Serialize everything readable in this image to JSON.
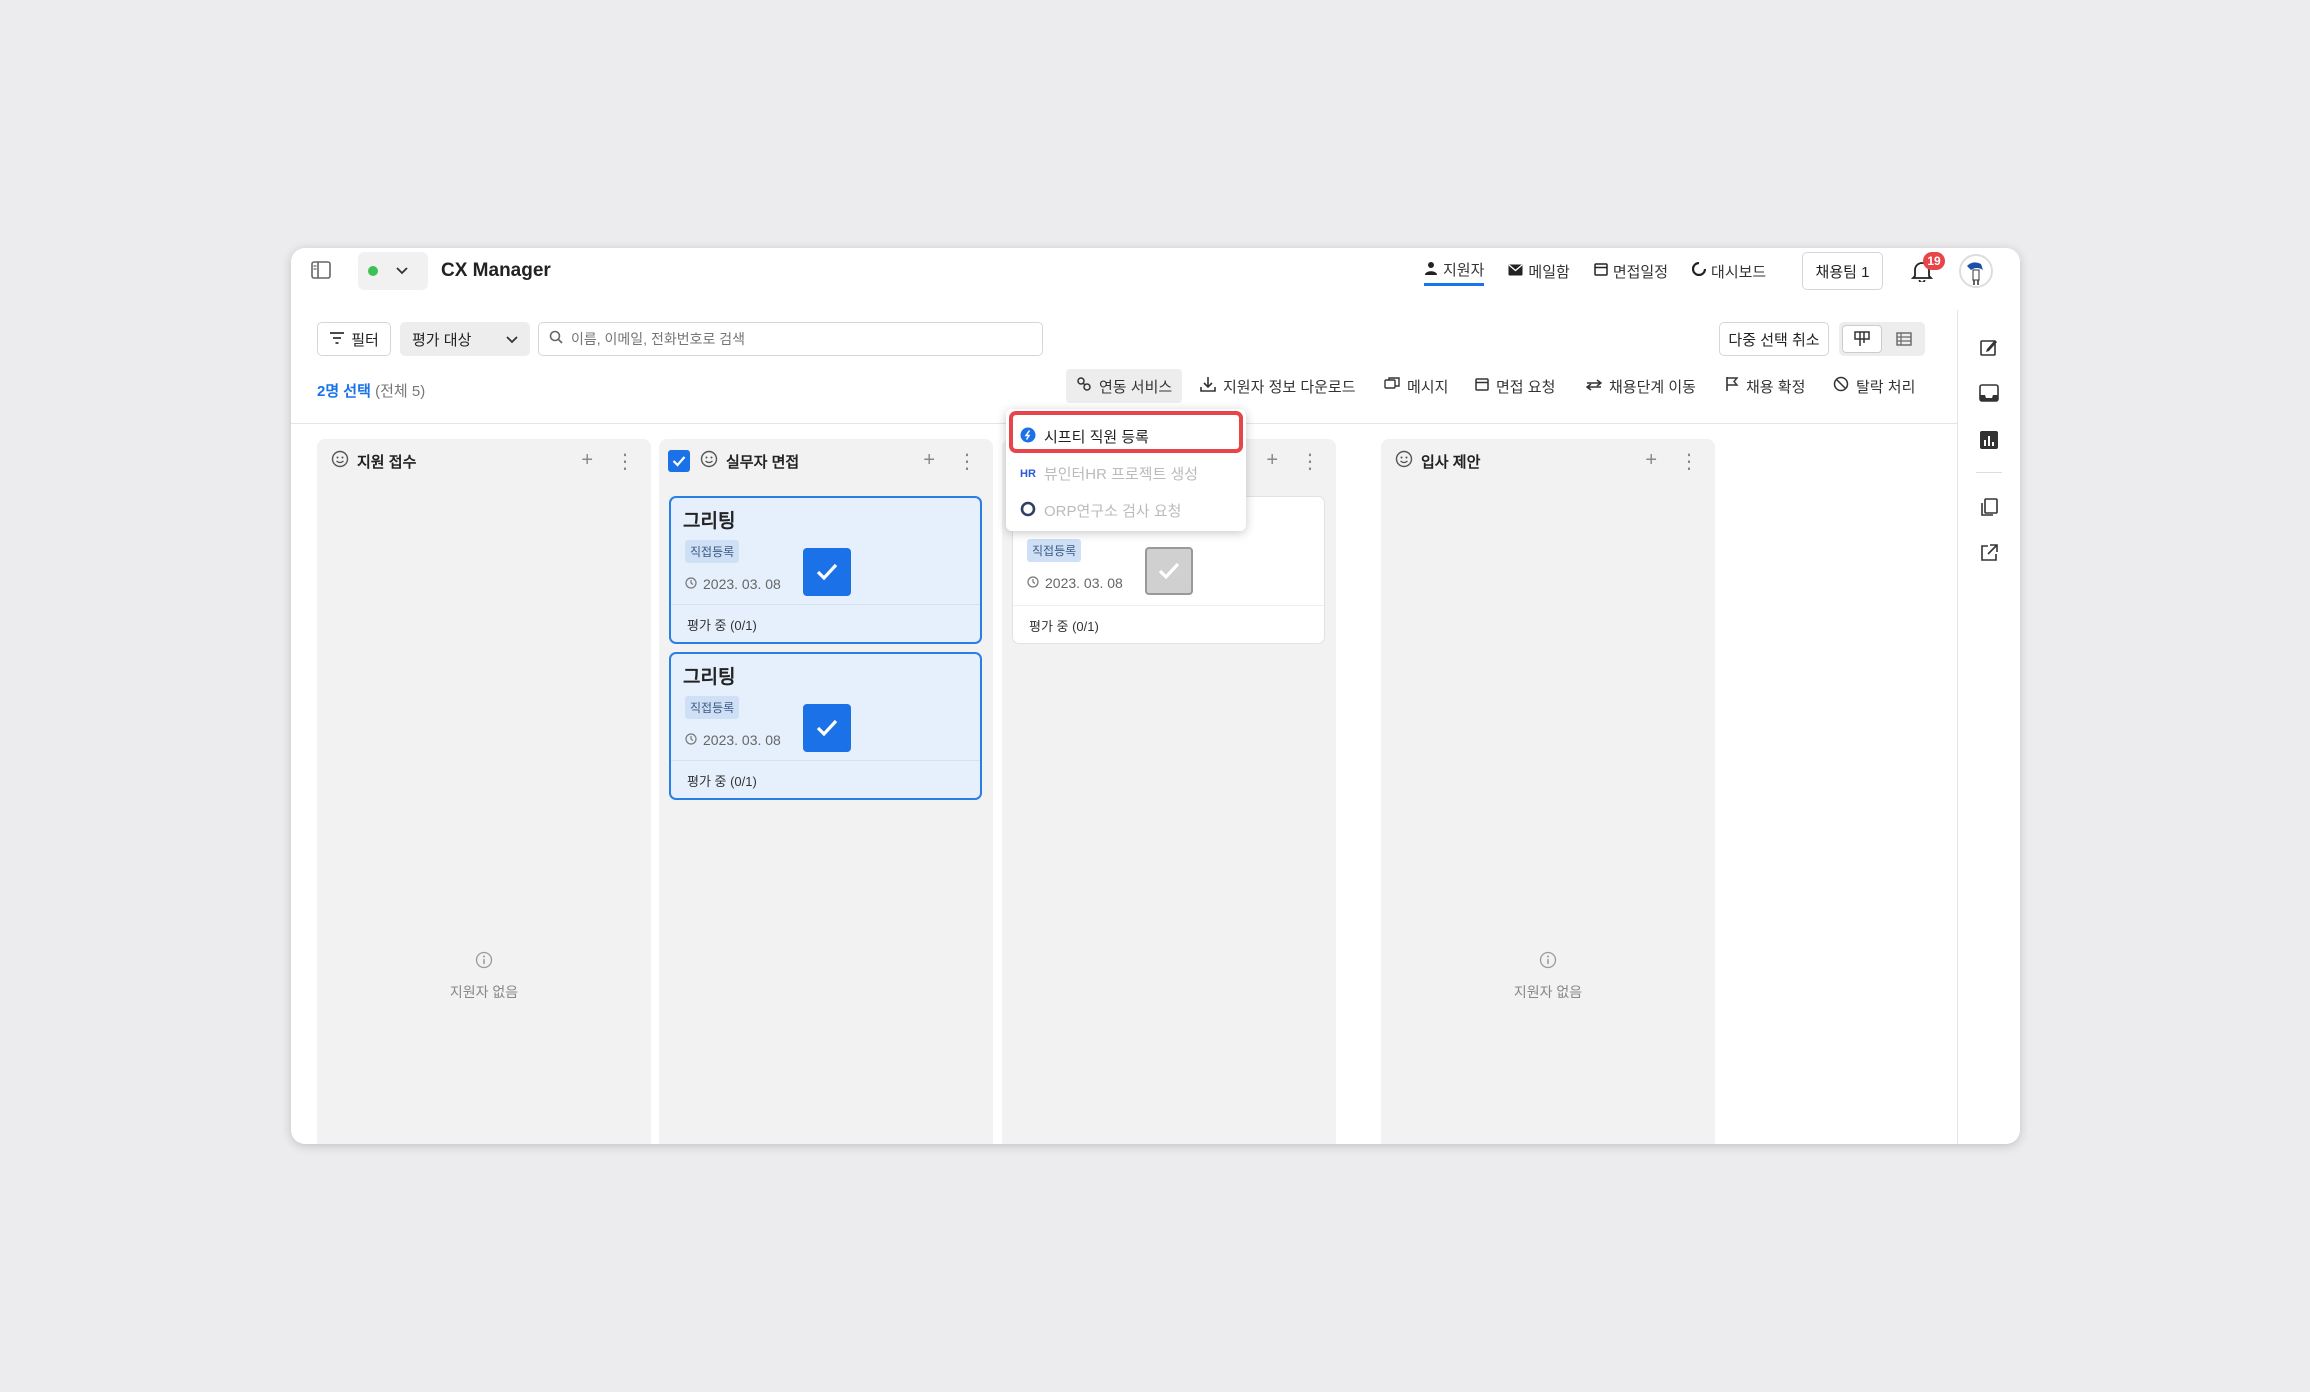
{
  "header": {
    "title": "CX Manager",
    "nav": [
      "지원자",
      "메일함",
      "면접일정",
      "대시보드"
    ],
    "team_button": "채용팀 1",
    "notification_count": "19"
  },
  "toolbar": {
    "filter_label": "필터",
    "eval_select": "평가 대상",
    "search_placeholder": "이름, 이메일, 전화번호로 검색",
    "multi_cancel": "다중 선택 취소"
  },
  "selection": {
    "selected": "2명 선택",
    "total": "(전체 5)"
  },
  "actions": {
    "linked_service": "연동 서비스",
    "download": "지원자 정보 다운로드",
    "message": "메시지",
    "interview_request": "면접 요청",
    "move_stage": "채용단계 이동",
    "confirm_hire": "채용 확정",
    "reject": "탈락 처리"
  },
  "dropdown": {
    "items": [
      "시프티 직원 등록",
      "뷰인터HR 프로젝트 생성",
      "ORP연구소 검사 요청"
    ],
    "hr_badge": "HR"
  },
  "columns": [
    {
      "title": "지원 접수",
      "empty_text": "지원자 없음"
    },
    {
      "title": "실무자 면접"
    },
    {
      "title": ""
    },
    {
      "title": "입사 제안",
      "empty_text": "지원자 없음"
    }
  ],
  "cards": [
    {
      "name": "그리팅",
      "tag": "직접등록",
      "date": "2023. 03. 08",
      "status": "평가 중 (0/1)"
    },
    {
      "name": "그리팅",
      "tag": "직접등록",
      "date": "2023. 03. 08",
      "status": "평가 중 (0/1)"
    },
    {
      "tag": "직접등록",
      "date": "2023. 03. 08",
      "status": "평가 중 (0/1)"
    }
  ],
  "colors": {
    "accent": "#1b72e8",
    "highlight": "#e8454b",
    "badge": "#e8454b"
  }
}
